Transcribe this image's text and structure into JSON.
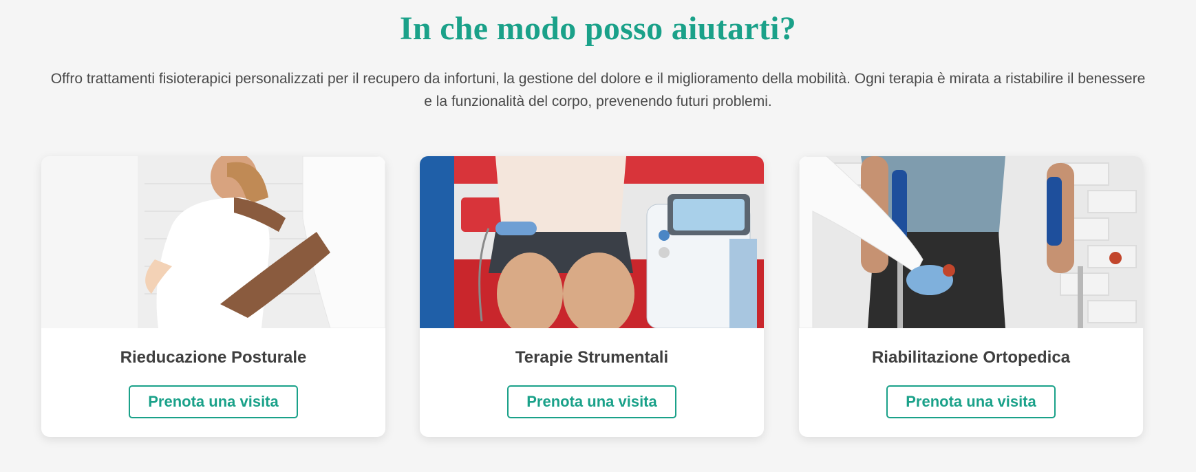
{
  "section": {
    "title": "In che modo posso aiutarti?",
    "intro": "Offro trattamenti fisioterapici personalizzati per il recupero da infortuni, la gestione del dolore e il miglioramento della mobilità. Ogni terapia è mirata a ristabilire il benessere e la funzionalità del corpo, prevenendo futuri problemi."
  },
  "services": [
    {
      "title": "Rieducazione Posturale",
      "button_label": "Prenota una visita"
    },
    {
      "title": "Terapie Strumentali",
      "button_label": "Prenota una visita"
    },
    {
      "title": "Riabilitazione Ortopedica",
      "button_label": "Prenota una visita"
    }
  ],
  "colors": {
    "accent": "#1aa189",
    "background": "#f5f5f5",
    "card": "#ffffff",
    "heading_text": "#3f3f3f"
  }
}
